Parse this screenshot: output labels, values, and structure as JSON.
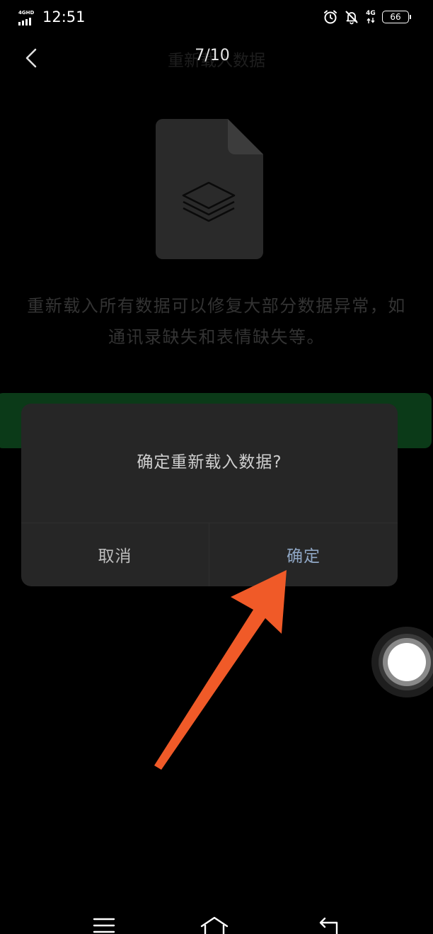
{
  "status_bar": {
    "network_label": "4GHD",
    "time": "12:51",
    "mobile_data_label": "4G",
    "battery_level": "66",
    "icons": [
      "alarm-icon",
      "bell-off-icon",
      "mobile-data-icon",
      "battery-icon"
    ]
  },
  "header": {
    "title": "重新载入数据",
    "page_counter": "7/10",
    "back_icon": "chevron-left-icon"
  },
  "content": {
    "illustration_icon": "layers-file-icon",
    "description_line1": "重新载入所有数据可以修复大部分数据异常，如",
    "description_line2": "通讯录缺失和表情缺失等。"
  },
  "dialog": {
    "message": "确定重新载入数据?",
    "cancel_label": "取消",
    "confirm_label": "确定"
  },
  "annotation": {
    "arrow_icon": "pointer-arrow-icon",
    "arrow_color": "#F05A28"
  },
  "assist": {
    "icon": "assistive-touch-icon"
  },
  "nav_bar": {
    "icons": [
      "menu-icon",
      "home-icon",
      "back-icon"
    ]
  },
  "colors": {
    "background": "#000000",
    "dialog_background": "#262626",
    "confirm_text": "#8FA6C4",
    "primary_button": "#0B3A18"
  }
}
